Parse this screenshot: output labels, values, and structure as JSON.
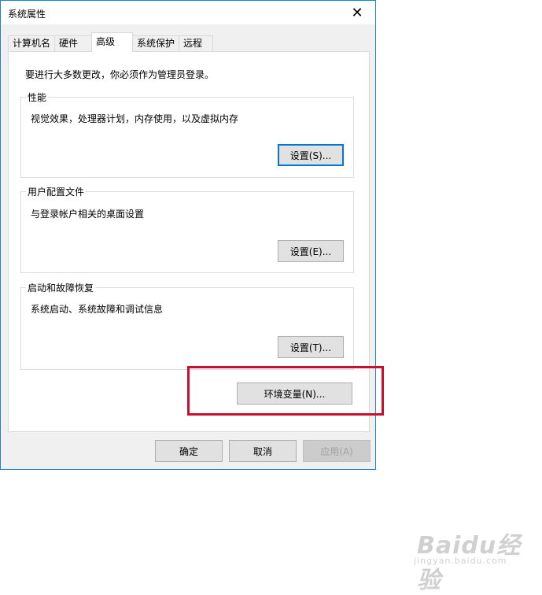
{
  "window": {
    "title": "系统属性"
  },
  "tabs": [
    {
      "label": "计算机名"
    },
    {
      "label": "硬件"
    },
    {
      "label": "高级"
    },
    {
      "label": "系统保护"
    },
    {
      "label": "远程"
    }
  ],
  "active_tab": "高级",
  "intro_text": "要进行大多数更改，你必须作为管理员登录。",
  "groups": {
    "performance": {
      "title": "性能",
      "description": "视觉效果，处理器计划，内存使用，以及虚拟内存",
      "button": "设置(S)..."
    },
    "user_profiles": {
      "title": "用户配置文件",
      "description": "与登录帐户相关的桌面设置",
      "button": "设置(E)..."
    },
    "startup_recovery": {
      "title": "启动和故障恢复",
      "description": "系统启动、系统故障和调试信息",
      "button": "设置(T)..."
    }
  },
  "env_button": "环境变量(N)...",
  "footer": {
    "ok": "确定",
    "cancel": "取消",
    "apply": "应用(A)"
  },
  "watermark": {
    "logo": "Baidu经验",
    "url": "jingyan.baidu.com"
  },
  "colors": {
    "highlight": "#c8102e",
    "focus_border": "#0078d7",
    "window_border": "#1883d7"
  }
}
